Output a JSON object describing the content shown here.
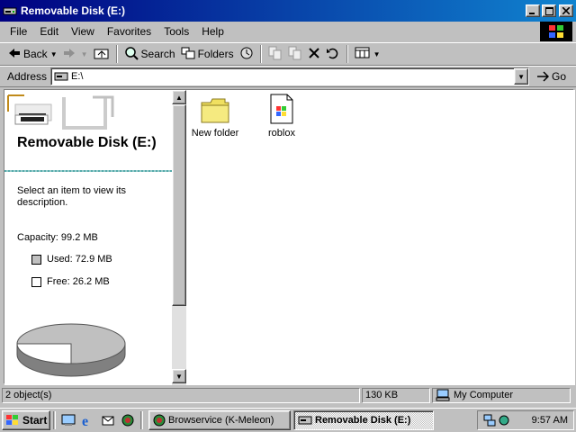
{
  "window": {
    "title": "Removable Disk (E:)",
    "buttons": {
      "minimize": "minimize",
      "maximize": "maximize",
      "close": "close"
    }
  },
  "menu": [
    "File",
    "Edit",
    "View",
    "Favorites",
    "Tools",
    "Help"
  ],
  "toolbar": {
    "back_label": "Back",
    "search_label": "Search",
    "folders_label": "Folders"
  },
  "address": {
    "label": "Address",
    "value": "E:\\",
    "go_label": "Go"
  },
  "info_pane": {
    "title": "Removable Disk (E:)",
    "description": "Select an item to view its description.",
    "capacity": "Capacity: 99.2 MB",
    "used": "Used: 72.9 MB",
    "free": "Free: 26.2 MB",
    "used_color": "#c0c0c0",
    "free_color": "#ffffff"
  },
  "files": [
    {
      "name": "New folder",
      "icon": "folder-icon"
    },
    {
      "name": "roblox",
      "icon": "document-icon"
    }
  ],
  "status": {
    "objects": "2 object(s)",
    "size": "130 KB",
    "zone": "My Computer"
  },
  "taskbar": {
    "start_label": "Start",
    "tasks": [
      "Browservice (K-Meleon)",
      "Removable Disk (E:)"
    ],
    "time": "9:57 AM"
  },
  "colors": {
    "titlebar_start": "#000080",
    "titlebar_end": "#1084d0",
    "face": "#c0c0c0"
  }
}
